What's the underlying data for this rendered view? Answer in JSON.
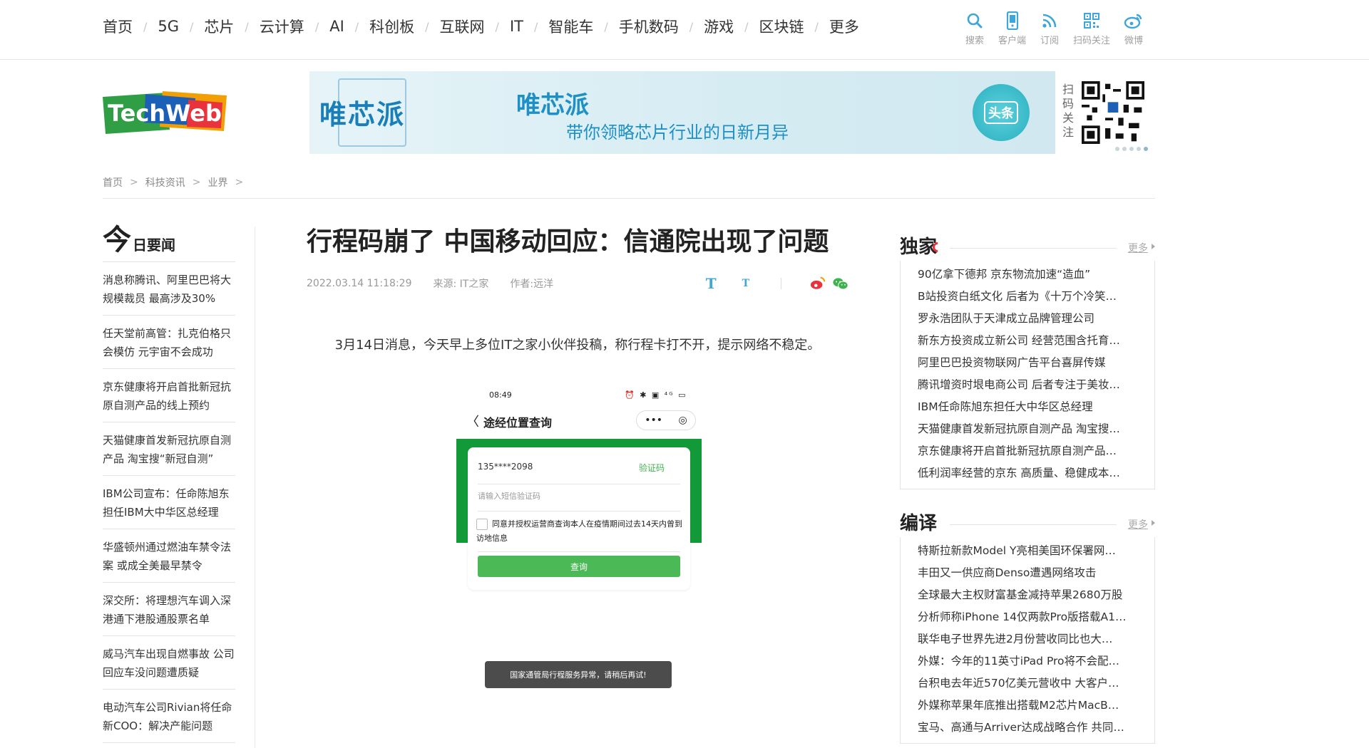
{
  "nav": {
    "items": [
      "首页",
      "5G",
      "芯片",
      "云计算",
      "AI",
      "科创板",
      "互联网",
      "IT",
      "智能车",
      "手机数码",
      "游戏",
      "区块链",
      "更多"
    ],
    "icons": [
      {
        "label": "搜索",
        "icon": "search-icon"
      },
      {
        "label": "客户端",
        "icon": "mobile-client-icon"
      },
      {
        "label": "订阅",
        "icon": "rss-icon"
      },
      {
        "label": "扫码关注",
        "icon": "qr-code-icon"
      },
      {
        "label": "微博",
        "icon": "weibo-icon"
      }
    ],
    "sep": "/"
  },
  "logo": {
    "text": "TechWeb"
  },
  "banner": {
    "logo_text": "唯芯派",
    "title": "唯芯派",
    "slogan": "带你领略芯片行业的日新月异",
    "badge": "头条",
    "qr_caption": "扫码关注"
  },
  "breadcrumb": {
    "items": [
      "首页",
      "科技资讯",
      "业界"
    ],
    "sep": ">"
  },
  "left": {
    "title_big": "今",
    "title_small": "日要闻",
    "items": [
      "消息称腾讯、阿里巴巴将大规模裁员 最高涉及30%",
      "任天堂前高管：扎克伯格只会模仿 元宇宙不会成功",
      "京东健康将开启首批新冠抗原自测产品的线上预约",
      "天猫健康首发新冠抗原自测产品 淘宝搜“新冠自测”",
      "IBM公司宣布：任命陈旭东担任IBM大中华区总经理",
      "华盛顿州通过燃油车禁令法案 或成全美最早禁令",
      "深交所：将理想汽车调入深港通下港股通股票名单",
      "威马汽车出现自燃事故 公司回应车没问题遭质疑",
      "电动汽车公司Rivian将任命新COO：解决产能问题"
    ]
  },
  "article": {
    "title": "行程码崩了 中国移动回应：信通院出现了问题",
    "date": "2022.03.14 11:18:29",
    "source": "来源: IT之家",
    "author": "作者:远洋",
    "font_large": "T",
    "font_small": "T",
    "paragraph": "3月14日消息，今天早上多位IT之家小伙伴投稿，称行程卡打不开，提示网络不稳定。",
    "phone": {
      "time": "08:49",
      "status_icons": "⏰ ✱ ▣ ⁴ᴳ ▭",
      "nav_back": "〈",
      "nav_title": "途经位置查询",
      "capsule_dots": "•••",
      "capsule_target": "◎",
      "phone_number": "135****2098",
      "verify_code": "验证码",
      "sms_placeholder": "请输入短信验证码",
      "consent": "同意并授权运营商查询本人在疫情期间过去14天内曾到访地信息",
      "query_button": "查询",
      "toast": "国家通管局行程服务异常，请稍后再试!"
    }
  },
  "exclusive": {
    "title": "独家",
    "more": "更多",
    "items": [
      "90亿拿下德邦 京东物流加速“造血”",
      "B站投资白纸文化 后者为《十万个冷笑…",
      "罗永浩团队于天津成立品牌管理公司",
      "新东方投资成立新公司 经营范围含托育…",
      "阿里巴巴投资物联网广告平台喜屏传媒",
      "腾讯增资时垠电商公司 后者专注于美妆…",
      "IBM任命陈旭东担任大中华区总经理",
      "天猫健康首发新冠抗原自测产品 淘宝搜…",
      "京东健康将开启首批新冠抗原自测产品…",
      "低利润率经营的京东 高质量、稳健成本…"
    ]
  },
  "translation": {
    "title": "编译",
    "more": "更多",
    "items": [
      "特斯拉新款Model Y亮相美国环保署网…",
      "丰田又一供应商Denso遭遇网络攻击",
      "全球最大主权财富基金减持苹果2680万股",
      "分析师称iPhone 14仅两款Pro版搭载A1…",
      "联华电子世界先进2月份营收同比也大…",
      "外媒：今年的11英寸iPad Pro将不会配…",
      "台积电去年近570亿美元营收中 大客户…",
      "外媒称苹果年底推出搭载M2芯片MacB…",
      "宝马、高通与Arriver达成战略合作 共同…"
    ]
  },
  "colors": {
    "accent_blue": "#3ea6d8",
    "weibo_red": "#e8323c",
    "wechat_green": "#3fb24e",
    "phone_green": "#139a38"
  }
}
